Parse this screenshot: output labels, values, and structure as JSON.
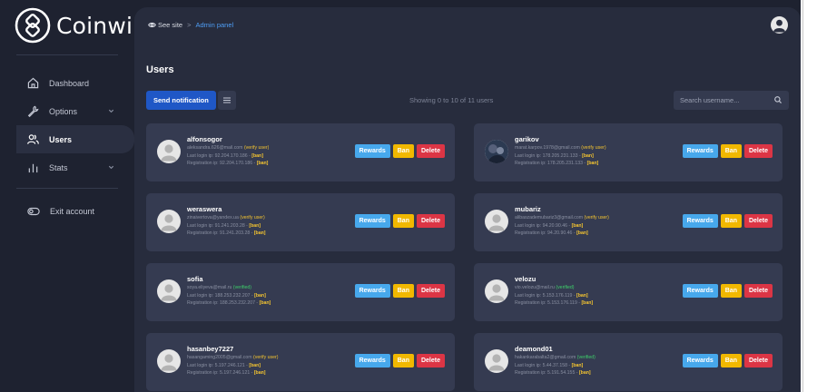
{
  "brand": {
    "name": "Coinwin"
  },
  "sidebar": {
    "items": [
      {
        "label": "Dashboard",
        "icon": "home-icon",
        "active": false,
        "has_chevron": false
      },
      {
        "label": "Options",
        "icon": "wrench-icon",
        "active": false,
        "has_chevron": true
      },
      {
        "label": "Users",
        "icon": "users-icon",
        "active": true,
        "has_chevron": false
      },
      {
        "label": "Stats",
        "icon": "bar-chart-icon",
        "active": false,
        "has_chevron": true
      }
    ],
    "exit_label": "Exit account"
  },
  "breadcrumb": {
    "see_site": "See site",
    "separator": ">",
    "current": "Admin panel"
  },
  "page": {
    "title": "Users"
  },
  "toolbar": {
    "notify_label": "Send notification",
    "showing_text": "Showing 0 to 10 of 11 users",
    "search_placeholder": "Search username..."
  },
  "buttons": {
    "rewards": "Rewards",
    "ban": "Ban",
    "delete": "Delete"
  },
  "users": [
    {
      "username": "alfonsogor",
      "email": "aleksandra.626@mail.com",
      "status": "(verify user)",
      "status_type": "verify",
      "last_login_label": "Last login ip: 92.204.170.186 - ",
      "reg_label": "Registration ip: 92.204.170.186 - ",
      "ban_tag": "[ban]",
      "avatar": "default"
    },
    {
      "username": "garikov",
      "email": "marat.karpov.1978@gmail.com",
      "status": "(verify user)",
      "status_type": "verify",
      "last_login_label": "Last login ip: 178.205.231.133 - ",
      "reg_label": "Registration ip: 178.205.231.133 - ",
      "ban_tag": "[ban]",
      "avatar": "photo"
    },
    {
      "username": "weraswera",
      "email": "zinaivertova@yandex.ua",
      "status": "(verify user)",
      "status_type": "verify",
      "last_login_label": "Last login ip: 91.241.203.28 - ",
      "reg_label": "Registration ip: 91.241.203.28 - ",
      "ban_tag": "[ban]",
      "avatar": "default"
    },
    {
      "username": "mubariz",
      "email": "alibaszademubariz3@gmail.com",
      "status": "(verify user)",
      "status_type": "verify",
      "last_login_label": "Last login ip: 94.20.90.46 - ",
      "reg_label": "Registration ip: 94.20.90.46 - ",
      "ban_tag": "[ban]",
      "avatar": "default"
    },
    {
      "username": "sofia",
      "email": "soya.eliyeva@mail.ru",
      "status": "(verified)",
      "status_type": "verified",
      "last_login_label": "Last login ip: 188.253.232.207 - ",
      "reg_label": "Registration ip: 188.253.232.207 - ",
      "ban_tag": "[ban]",
      "avatar": "default"
    },
    {
      "username": "velozu",
      "email": "vio.velozu@mail.ru",
      "status": "(verified)",
      "status_type": "verified",
      "last_login_label": "Last login ip: 5.153.176.119 - ",
      "reg_label": "Registration ip: 5.153.176.119 - ",
      "ban_tag": "[ban]",
      "avatar": "default"
    },
    {
      "username": "hasanbey7227",
      "email": "hasangaming2005@gmail.com",
      "status": "(verify user)",
      "status_type": "verify",
      "last_login_label": "Last login ip: 5.197.246.121 - ",
      "reg_label": "Registration ip: 5.197.246.121 - ",
      "ban_tag": "[ban]",
      "avatar": "default"
    },
    {
      "username": "deamond01",
      "email": "hakankarabalta2@gmail.com",
      "status": "(verified)",
      "status_type": "verified",
      "last_login_label": "Last login ip: 5.44.37.158 - ",
      "reg_label": "Registration ip: 5.191.54.155 - ",
      "ban_tag": "[ban]",
      "avatar": "default"
    }
  ],
  "colors": {
    "accent": "#1f57c6",
    "rewards": "#47a8ec",
    "ban": "#f1b800",
    "delete": "#dc3545",
    "verify": "#f4c430",
    "verified": "#3ecf6a"
  }
}
